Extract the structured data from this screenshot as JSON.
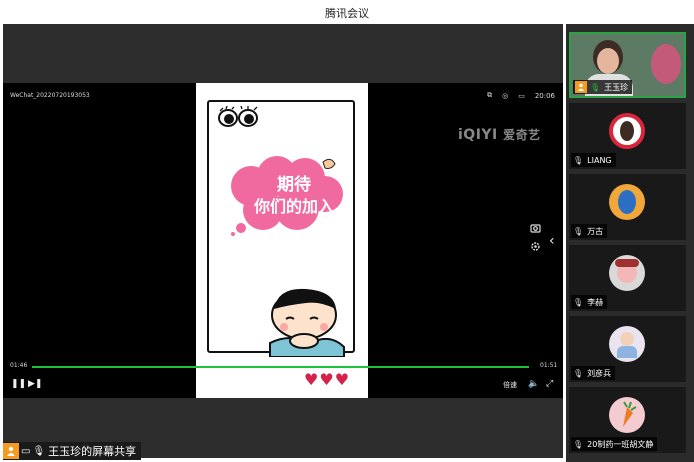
{
  "window": {
    "title": "腾讯会议"
  },
  "player": {
    "filename": "WeChat_20220720193053",
    "clock": "20:06",
    "watermark_latin": "iQIYI",
    "watermark_cn": "爱奇艺",
    "time_current": "01:46",
    "time_total": "01:51",
    "progress_fraction": 0.95,
    "speed_label": "倍速",
    "accent_color": "#1ec33a"
  },
  "video_content": {
    "cloud_line1": "期待",
    "cloud_line2": "你们的加入",
    "cloud_color": "#f06aa0"
  },
  "share_label": {
    "text": "王玉珍的屏幕共享"
  },
  "participants": [
    {
      "name": "王玉珍",
      "active": true,
      "avatar": "camera-video"
    },
    {
      "name": "LIANG",
      "active": false,
      "avatar": "portrait-ring"
    },
    {
      "name": "万古",
      "active": false,
      "avatar": "blue-bird"
    },
    {
      "name": "李赫",
      "active": false,
      "avatar": "pig-character"
    },
    {
      "name": "刘彦兵",
      "active": false,
      "avatar": "cartoon-kid"
    },
    {
      "name": "20制药一班胡文静",
      "active": false,
      "avatar": "carrot"
    }
  ]
}
